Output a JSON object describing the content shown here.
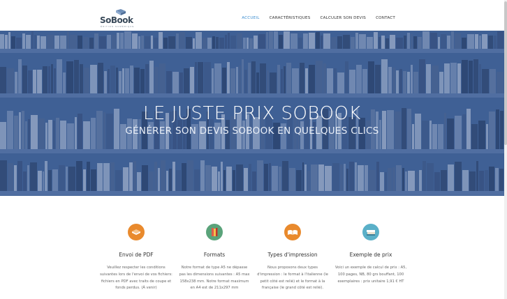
{
  "brand": {
    "name": "SoBook",
    "tagline": "ÉDITION NUMÉRIQUE",
    "book_color": "#6f8fb8"
  },
  "nav": {
    "items": [
      {
        "label": "ACCUEIL",
        "active": true
      },
      {
        "label": "CARACTÉRISTIQUES",
        "active": false
      },
      {
        "label": "CALCULER SON DEVIS",
        "active": false
      },
      {
        "label": "CONTACT",
        "active": false
      }
    ],
    "active_color": "#3d8fd1"
  },
  "hero": {
    "title": "LE JUSTE PRIX SOBOOK",
    "subtitle": "GÉNÉRER SON DEVIS SOBOOK EN QUELQUES CLICS",
    "overlay_color": "#3f5f93"
  },
  "features": [
    {
      "icon": "pdf-icon",
      "icon_color": "#e98a2d",
      "title": "Envoi de PDF",
      "text": "Veuillez respecter les conditions suivantes lors de l'envoi de vos fichiers: fichiers en PDF avec traits de coupe et fonds perdus. (À venir)"
    },
    {
      "icon": "books-icon",
      "icon_color": "#5aa37a",
      "title": "Formats",
      "text": "Notre format de type A5 ne dépasse pas les dimensions suivantes : A5 max 158x238 mm. Notre format maximum en A4 est de 211x297 mm"
    },
    {
      "icon": "open-book-icon",
      "icon_color": "#e98a2d",
      "title": "Types d'impression",
      "text": "Nous proposons deux types d'impression : le format à l'italienne (le petit côté est relié) et le format à la française (le grand côté est relié)."
    },
    {
      "icon": "book-stack-icon",
      "icon_color": "#5ab0c8",
      "title": "Exemple de prix",
      "text": "Voici un exemple de calcul de prix : A5, 100 pages, NB, 80 grs bouffant, 100 exemplaires : prix unitaire 1,91 € HT"
    }
  ]
}
